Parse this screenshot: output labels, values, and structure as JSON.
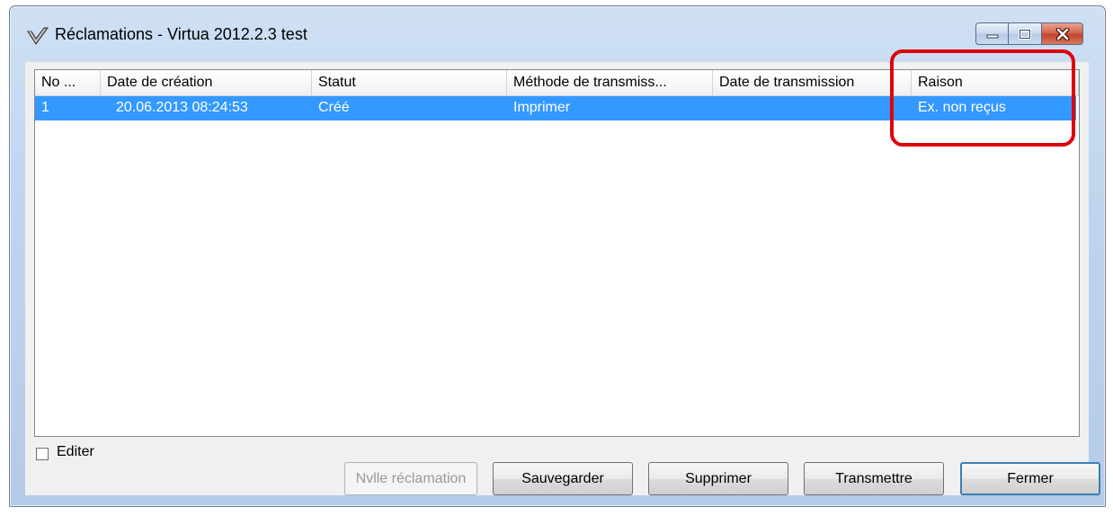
{
  "window": {
    "title": "Réclamations - Virtua 2012.2.3 test",
    "app_icon": "virtua-check-icon",
    "controls": [
      "minimize-icon",
      "maximize-icon",
      "close-icon"
    ]
  },
  "table": {
    "columns": [
      "No ...",
      "Date de création",
      "Statut",
      "Méthode de transmiss...",
      "Date de transmission",
      "Raison"
    ],
    "rows": [
      {
        "no": "1",
        "date_creation": "20.06.2013 08:24:53",
        "statut": "Créé",
        "methode": "Imprimer",
        "date_transmission": "",
        "raison": "Ex. non reçus",
        "selected": true
      }
    ]
  },
  "edit_checkbox": {
    "label": "Editer",
    "checked": false
  },
  "buttons": {
    "new_claim": "Nvlle réclamation",
    "save": "Sauvegarder",
    "delete": "Supprimer",
    "transmit": "Transmettre",
    "close": "Fermer"
  },
  "colors": {
    "selection": "#3399ff",
    "annotation": "#e0000a"
  }
}
